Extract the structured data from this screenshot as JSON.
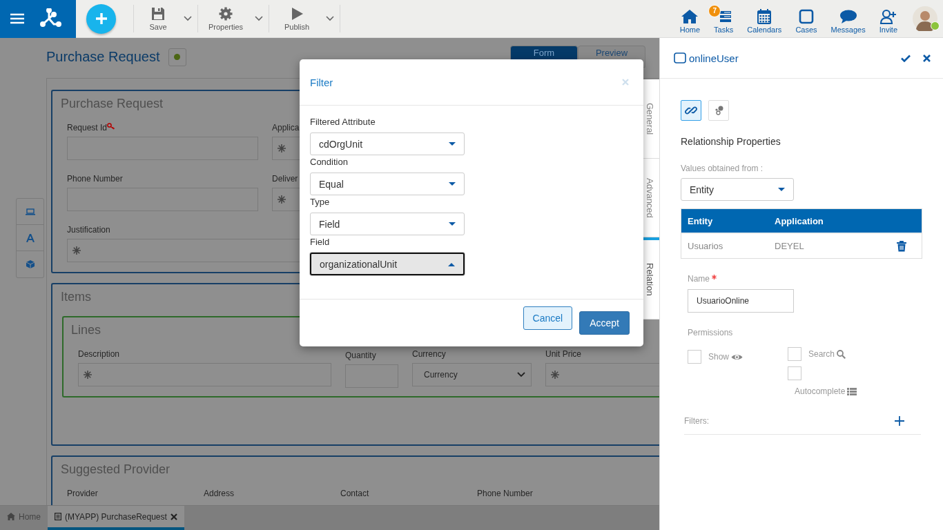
{
  "topbar": {
    "actions": [
      {
        "label": "Save"
      },
      {
        "label": "Properties"
      },
      {
        "label": "Publish"
      }
    ],
    "nav": [
      {
        "label": "Home"
      },
      {
        "label": "Tasks",
        "badge": "7"
      },
      {
        "label": "Calendars"
      },
      {
        "label": "Cases"
      },
      {
        "label": "Messages"
      },
      {
        "label": "Invite"
      }
    ],
    "user": {
      "online": true
    }
  },
  "page": {
    "title": "Purchase Request",
    "tabs": [
      {
        "label": "Form",
        "selected": true
      },
      {
        "label": "Preview",
        "selected": false
      }
    ],
    "side_tabs": [
      {
        "label": "General",
        "selected": false
      },
      {
        "label": "Advanced",
        "selected": false
      },
      {
        "label": "Relation",
        "selected": true
      }
    ],
    "sections": [
      {
        "title": "Purchase Request",
        "rows": [
          [
            {
              "label": "Request Id",
              "kind": "input",
              "key": true,
              "marked": false
            },
            {
              "label": "Applica",
              "kind": "input",
              "key": false,
              "marked": true
            }
          ],
          [
            {
              "label": "Phone Number",
              "kind": "input",
              "key": false,
              "marked": false
            },
            {
              "label": "Deliver",
              "kind": "input",
              "key": false,
              "marked": true
            }
          ],
          [
            {
              "label": "Justification",
              "kind": "input",
              "key": false,
              "marked": true
            }
          ]
        ]
      },
      {
        "title": "Items",
        "groups": [
          {
            "title": "Lines",
            "fields": [
              {
                "label": "Description",
                "kind": "input",
                "key": false,
                "marked": true
              },
              {
                "label": "Quantity",
                "kind": "input",
                "key": false,
                "marked": false
              },
              {
                "label": "Currency",
                "kind": "select",
                "value": "Currency"
              },
              {
                "label": "Unit Price",
                "kind": "input",
                "key": false,
                "marked": true
              }
            ]
          }
        ]
      },
      {
        "title": "Suggested Provider",
        "rows": [
          [
            {
              "label": "Provider"
            },
            {
              "label": "Address"
            },
            {
              "label": "Contact"
            },
            {
              "label": "Phone Number"
            }
          ]
        ]
      }
    ]
  },
  "modal": {
    "title": "Filter",
    "fields": [
      {
        "label": "Filtered Attribute",
        "value": "cdOrgUnit",
        "expanded": false
      },
      {
        "label": "Condition",
        "value": "Equal",
        "expanded": false
      },
      {
        "label": "Type",
        "value": "Field",
        "expanded": false
      },
      {
        "label": "Field",
        "value": "organizationalUnit",
        "expanded": true
      }
    ],
    "buttons": [
      {
        "label": "Cancel",
        "kind": "secondary"
      },
      {
        "label": "Accept",
        "kind": "primary"
      }
    ]
  },
  "panel": {
    "title": "onlineUser",
    "modes": [
      {
        "selected": true
      },
      {
        "selected": false
      }
    ],
    "heading": "Relationship Properties",
    "source_label": "Values obtained from :",
    "source_value": "Entity",
    "table": {
      "columns": [
        "Entity",
        "Application"
      ],
      "rows": [
        [
          "Usuarios",
          "DEYEL"
        ]
      ]
    },
    "name": {
      "label": "Name",
      "required": true,
      "value": "UsuarioOnline"
    },
    "permissions": {
      "label": "Permissions",
      "options": [
        {
          "label": "Show",
          "kind": "inline",
          "checked": false
        },
        {
          "label": "Search",
          "kind": "inline",
          "checked": false
        },
        {
          "label": "Autocomplete",
          "kind": "stacked",
          "checked": false
        }
      ]
    },
    "filters_label": "Filters:"
  },
  "bottom_tabs": [
    {
      "label": "Home",
      "selected": false,
      "closable": false
    },
    {
      "label": "(MYAPP) PurchaseRequest",
      "selected": true,
      "closable": true
    }
  ]
}
